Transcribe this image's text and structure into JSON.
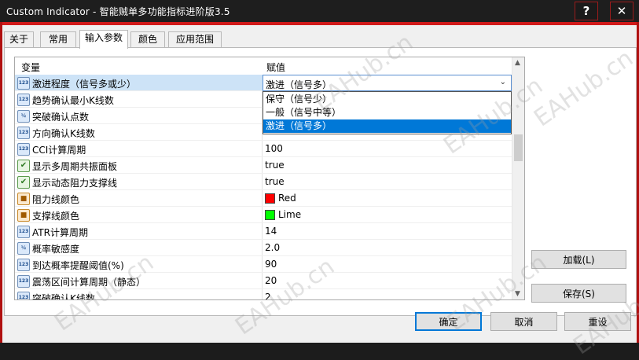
{
  "window": {
    "title": "Custom Indicator - 智能贼单多功能指标进阶版3.5",
    "help_glyph": "?",
    "close_glyph": "✕"
  },
  "tabs": [
    {
      "label": "关于"
    },
    {
      "label": "常用"
    },
    {
      "label": "输入参数"
    },
    {
      "label": "颜色"
    },
    {
      "label": "应用范围"
    }
  ],
  "grid": {
    "header_variable": "变量",
    "header_value": "赋值",
    "rows": [
      {
        "icon": "number-icon",
        "icon_text": "123",
        "name": "激进程度（信号多或少）",
        "value": "激进（信号多）",
        "selected": true
      },
      {
        "icon": "number-icon",
        "icon_text": "123",
        "name": "趋势确认最小K线数",
        "value": ""
      },
      {
        "icon": "decimal-icon",
        "icon_text": "½",
        "name": "突破确认点数",
        "value": ""
      },
      {
        "icon": "number-icon",
        "icon_text": "123",
        "name": "方向确认K线数",
        "value": ""
      },
      {
        "icon": "number-icon",
        "icon_text": "123",
        "name": "CCI计算周期",
        "value": "100"
      },
      {
        "icon": "bool-icon",
        "icon_text": "✔",
        "name": "显示多周期共振面板",
        "value": "true"
      },
      {
        "icon": "bool-icon",
        "icon_text": "✔",
        "name": "显示动态阻力支撑线",
        "value": "true"
      },
      {
        "icon": "color-icon",
        "icon_text": "■",
        "name": "阻力线颜色",
        "value": "Red",
        "color": "#ff0000"
      },
      {
        "icon": "color-icon",
        "icon_text": "■",
        "name": "支撑线颜色",
        "value": "Lime",
        "color": "#00ff00"
      },
      {
        "icon": "number-icon",
        "icon_text": "123",
        "name": "ATR计算周期",
        "value": "14"
      },
      {
        "icon": "decimal-icon",
        "icon_text": "½",
        "name": "概率敏感度",
        "value": "2.0"
      },
      {
        "icon": "number-icon",
        "icon_text": "123",
        "name": "到达概率提醒阈值(%)",
        "value": "90"
      },
      {
        "icon": "number-icon",
        "icon_text": "123",
        "name": "震荡区间计算周期（静态）",
        "value": "20"
      },
      {
        "icon": "number-icon",
        "icon_text": "123",
        "name": "突破确认K线数",
        "value": "2"
      }
    ],
    "dropdown": {
      "current": "激进（信号多）",
      "options": [
        "保守（信号少）",
        "一般（信号中等）",
        "激进（信号多）"
      ],
      "highlighted_index": 2
    }
  },
  "buttons": {
    "load": "加载(L)",
    "save": "保存(S)",
    "ok": "确定",
    "cancel": "取消",
    "reset": "重设"
  },
  "watermark": "EAHub.cn",
  "colors": {
    "accent": "#0078d7",
    "titlebar": "#1e1e1e",
    "frame_red": "#d11a1a"
  }
}
